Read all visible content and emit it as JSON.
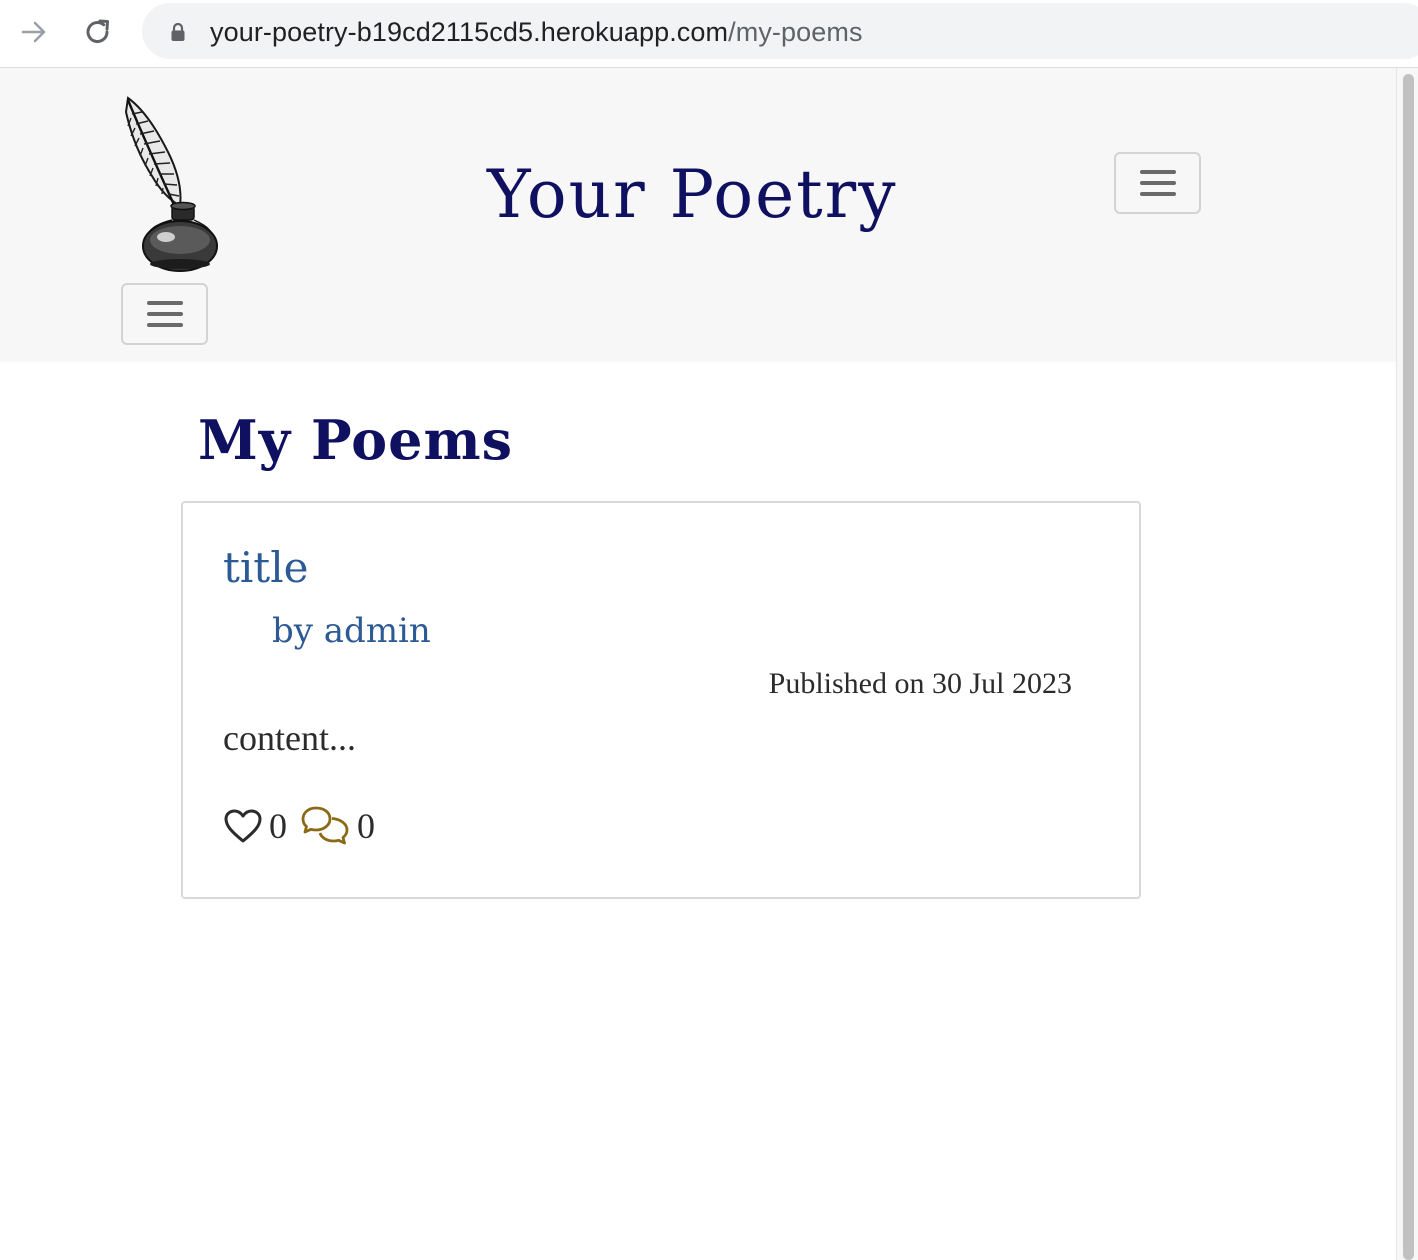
{
  "browser": {
    "url_host": "your-poetry-b19cd2115cd5.herokuapp.com",
    "url_path": "/my-poems",
    "forward_icon": "arrow-right-icon",
    "reload_icon": "reload-icon",
    "lock_icon": "lock-icon"
  },
  "header": {
    "brand": "Your Poetry",
    "logo_icon": "quill-inkwell-logo",
    "menu_icon": "hamburger-icon",
    "brand_color": "#0f1060",
    "background": "#f7f7f7"
  },
  "main": {
    "heading": "My Poems",
    "poems": [
      {
        "title": "title",
        "author": "by admin",
        "published": "Published on 30 Jul 2023",
        "excerpt": "content...",
        "likes": "0",
        "comments": "0",
        "like_icon": "heart-outline-icon",
        "comment_icon": "chat-bubbles-icon"
      }
    ]
  },
  "colors": {
    "link": "#2c5a94",
    "comment_icon": "#8a6a14",
    "text": "#2b2b2b"
  }
}
